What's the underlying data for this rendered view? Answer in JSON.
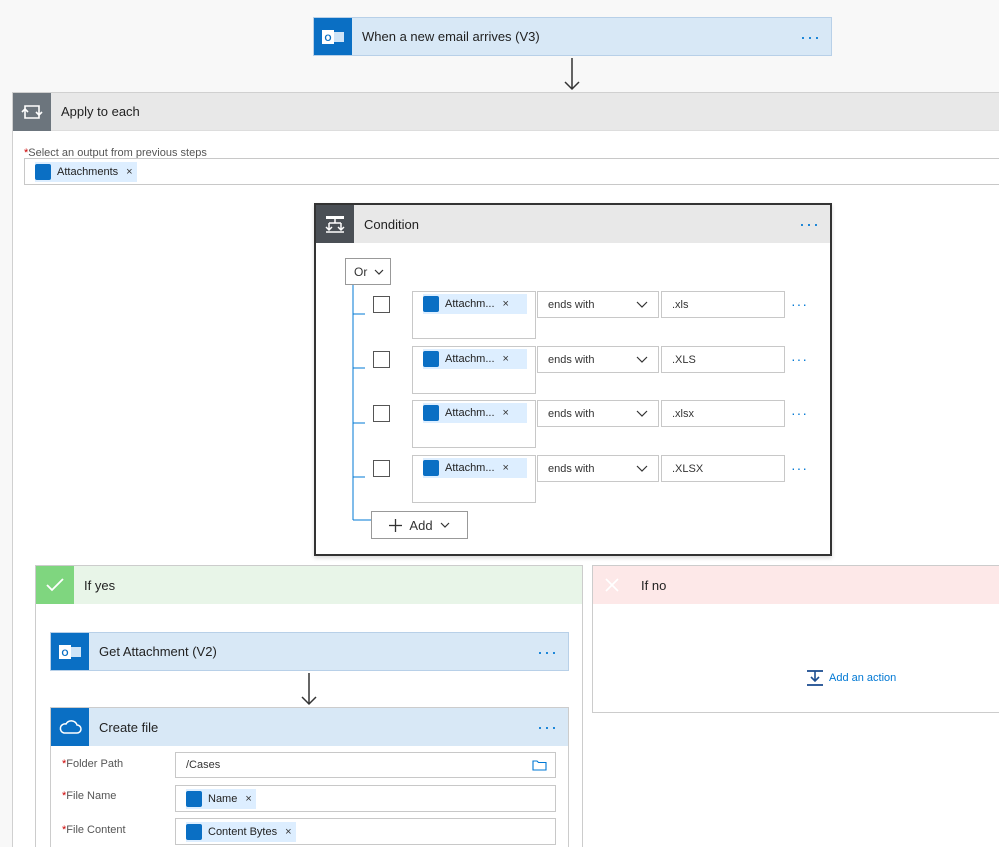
{
  "trigger": {
    "title": "When a new email arrives (V3)",
    "menu": "···"
  },
  "apply": {
    "title": "Apply to each",
    "field_label": "Select an output from previous steps",
    "token": "Attachments"
  },
  "condition": {
    "title": "Condition",
    "menu": "···",
    "group_operator": "Or",
    "rows": [
      {
        "token": "Attachm...",
        "operator": "ends with",
        "value": ".xls"
      },
      {
        "token": "Attachm...",
        "operator": "ends with",
        "value": ".XLS"
      },
      {
        "token": "Attachm...",
        "operator": "ends with",
        "value": ".xlsx"
      },
      {
        "token": "Attachm...",
        "operator": "ends with",
        "value": ".XLSX"
      }
    ],
    "add_label": "Add"
  },
  "if_yes": {
    "title": "If yes",
    "get_attachment": {
      "title": "Get Attachment (V2)",
      "menu": "···"
    },
    "create_file": {
      "title": "Create file",
      "menu": "···",
      "folder_label": "Folder Path",
      "folder_value": "/Cases",
      "name_label": "File Name",
      "name_token": "Name",
      "content_label": "File Content",
      "content_token": "Content Bytes"
    }
  },
  "if_no": {
    "title": "If no",
    "add_action": "Add an action"
  },
  "colors": {
    "accent": "#0078d4",
    "outlook": "#0a6fc4",
    "yes_bar": "#7fd67f",
    "no_bar": "#f28b8b",
    "header_blue": "#d8e8f6"
  }
}
